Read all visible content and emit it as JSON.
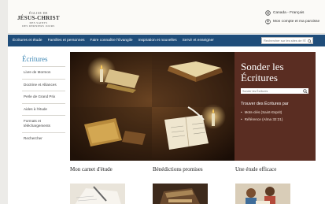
{
  "header": {
    "logo": {
      "line1": "ÉGLISE DE",
      "line2": "JÉSUS-CHRIST",
      "line3a": "DES SAINTS",
      "line3b": "DES DERNIERS JOURS"
    },
    "language_link": "Canada - Français",
    "account_link": "Mon compte et ma paroisse"
  },
  "nav": {
    "items": [
      "Écritures et étude",
      "Familles et personnes",
      "Faire connaître l'Évangile",
      "Inspiration et nouvelles",
      "Servir et enseigner"
    ],
    "search_placeholder": "Rechercher sur les sites de l'É"
  },
  "sidebar": {
    "title": "Écritures",
    "items": [
      "Livre de Mormon",
      "Doctrine et Alliances",
      "Perle de Grand Prix",
      "Aides à l'étude",
      "Formats et téléchargements",
      "Rechercher"
    ]
  },
  "hero": {
    "title_line1": "Sonder les",
    "title_line2": "Écritures",
    "search_placeholder": "Sonder les Écritures",
    "find_label": "Trouver des Écritures par",
    "options": [
      "Mots-clés (Saint-Esprit)",
      "Référence (Alma 32:21)"
    ]
  },
  "cards": [
    {
      "title": "Mon carnet d'étude"
    },
    {
      "title": "Bénédictions promises"
    },
    {
      "title": "Une étude efficace"
    }
  ],
  "colors": {
    "nav_bg": "#1f4d7a",
    "hero_panel": "#5a2d22",
    "accent": "#3f88b5"
  }
}
